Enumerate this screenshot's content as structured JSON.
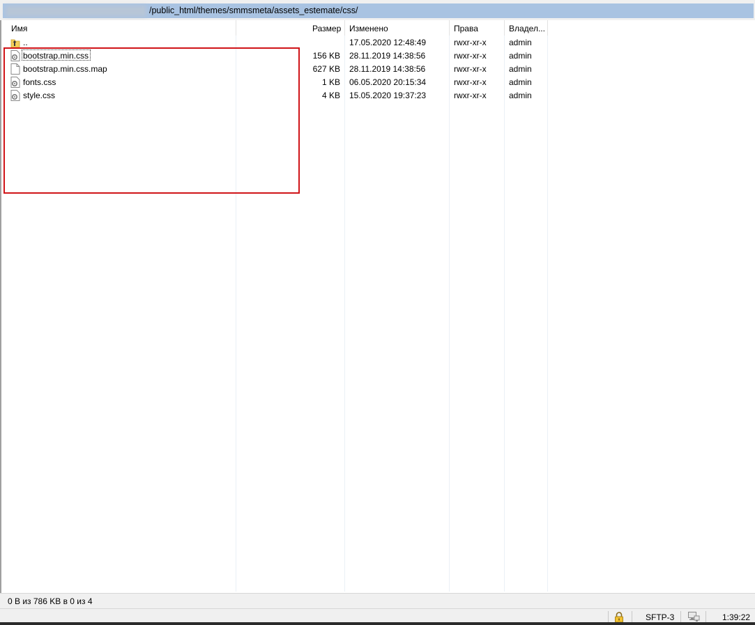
{
  "path": {
    "visible_text": "/public_html/themes/smmsmeta/assets_estemate/css/"
  },
  "columns": {
    "name": "Имя",
    "size": "Размер",
    "modified": "Изменено",
    "rights": "Права",
    "owner": "Владел..."
  },
  "files": [
    {
      "name": "..",
      "size": "",
      "modified": "17.05.2020 12:48:49",
      "rights": "rwxr-xr-x",
      "owner": "admin",
      "icon": "parent-folder-icon"
    },
    {
      "name": "bootstrap.min.css",
      "size": "156 KB",
      "modified": "28.11.2019 14:38:56",
      "rights": "rwxr-xr-x",
      "owner": "admin",
      "icon": "css-file-icon"
    },
    {
      "name": "bootstrap.min.css.map",
      "size": "627 KB",
      "modified": "28.11.2019 14:38:56",
      "rights": "rwxr-xr-x",
      "owner": "admin",
      "icon": "blank-file-icon"
    },
    {
      "name": "fonts.css",
      "size": "1 KB",
      "modified": "06.05.2020 20:15:34",
      "rights": "rwxr-xr-x",
      "owner": "admin",
      "icon": "css-file-icon"
    },
    {
      "name": "style.css",
      "size": "4 KB",
      "modified": "15.05.2020 19:37:23",
      "rights": "rwxr-xr-x",
      "owner": "admin",
      "icon": "css-file-icon"
    }
  ],
  "status": {
    "selection": "0 В из 786 KB в 0 из 4",
    "protocol": "SFTP-3",
    "elapsed": "1:39:22",
    "lock_icon": "lock-icon",
    "network_icon": "network-icon"
  },
  "colors": {
    "path_highlight": "#a9c3e2",
    "annotation_box": "#d01418"
  }
}
